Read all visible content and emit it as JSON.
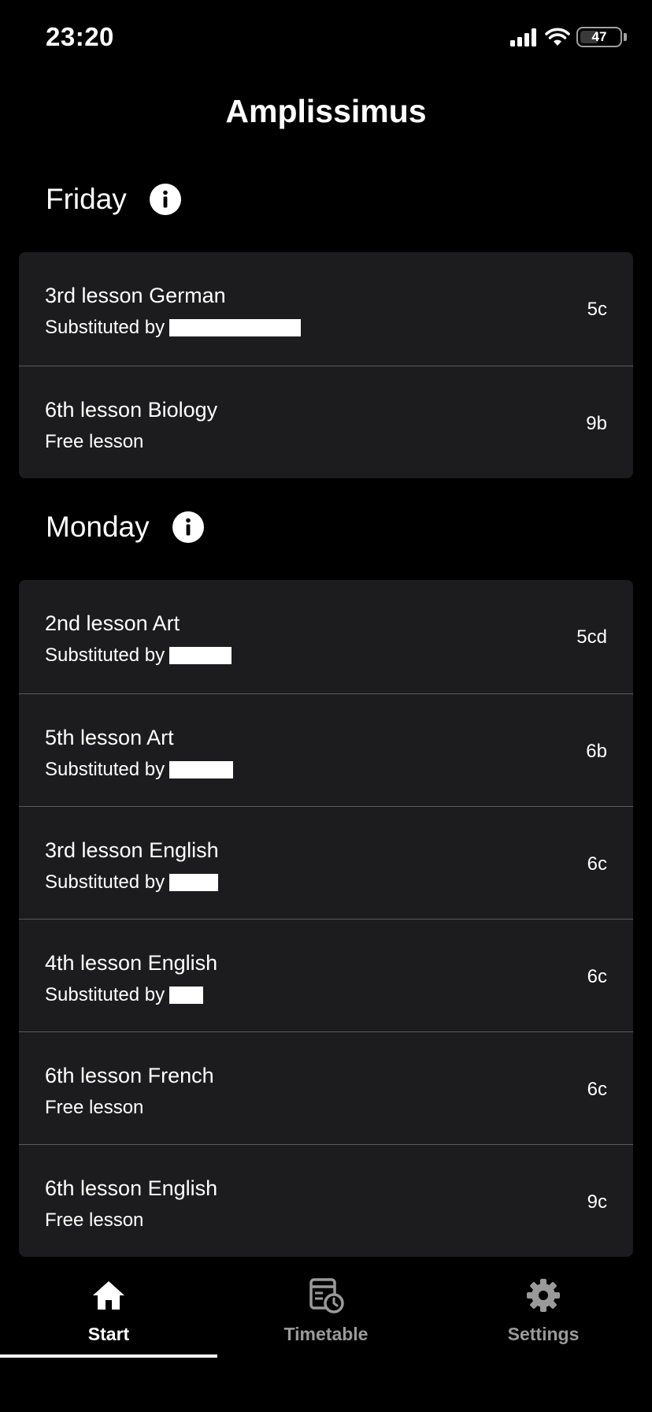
{
  "status_bar": {
    "time": "23:20",
    "battery_level": "47",
    "battery_fraction": 0.47
  },
  "header": {
    "title": "Amplissimus"
  },
  "colors": {
    "background": "#000000",
    "card": "#1c1c1e",
    "divider": "#5a5a5a",
    "text": "#ffffff",
    "tab_inactive": "#9a9a9a"
  },
  "days": [
    {
      "title": "Friday",
      "entries": [
        {
          "title": "3rd lesson German",
          "subtitle": "Substituted by",
          "class": "5c"
        },
        {
          "title": "6th lesson Biology",
          "subtitle": "Free lesson",
          "class": "9b"
        }
      ]
    },
    {
      "title": "Monday",
      "entries": [
        {
          "title": "2nd lesson Art",
          "subtitle": "Substituted by",
          "class": "5cd"
        },
        {
          "title": "5th lesson Art",
          "subtitle": "Substituted by",
          "class": "6b"
        },
        {
          "title": "3rd lesson English",
          "subtitle": "Substituted by",
          "class": "6c"
        },
        {
          "title": "4th lesson English",
          "subtitle": "Substituted by",
          "class": "6c"
        },
        {
          "title": "6th lesson French",
          "subtitle": "Free lesson",
          "class": "6c"
        },
        {
          "title": "6th lesson English",
          "subtitle": "Free lesson",
          "class": "9c"
        }
      ]
    }
  ],
  "tabs": [
    {
      "label": "Start",
      "icon": "home-icon",
      "active": true
    },
    {
      "label": "Timetable",
      "icon": "timetable-icon",
      "active": false
    },
    {
      "label": "Settings",
      "icon": "gear-icon",
      "active": false
    }
  ]
}
